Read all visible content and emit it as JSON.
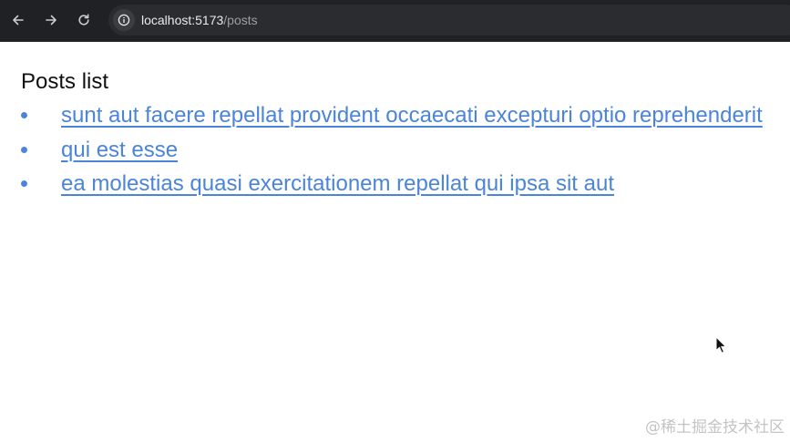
{
  "browser": {
    "url_host": "localhost:5173",
    "url_path": "/posts",
    "icons": {
      "back": "arrow-left-icon",
      "forward": "arrow-right-icon",
      "reload": "reload-icon",
      "site_info": "info-icon"
    },
    "colors": {
      "toolbar": "#202124",
      "omnibox": "#2b2c2f",
      "url_text": "#e8eaed"
    }
  },
  "page": {
    "heading": "Posts list",
    "posts": [
      {
        "title": "sunt aut facere repellat provident occaecati excepturi optio reprehenderit"
      },
      {
        "title": "qui est esse"
      },
      {
        "title": "ea molestias quasi exercitationem repellat qui ipsa sit aut"
      }
    ],
    "colors": {
      "link": "#4a85d9",
      "heading": "#111111"
    }
  },
  "watermark": "@稀土掘金技术社区"
}
